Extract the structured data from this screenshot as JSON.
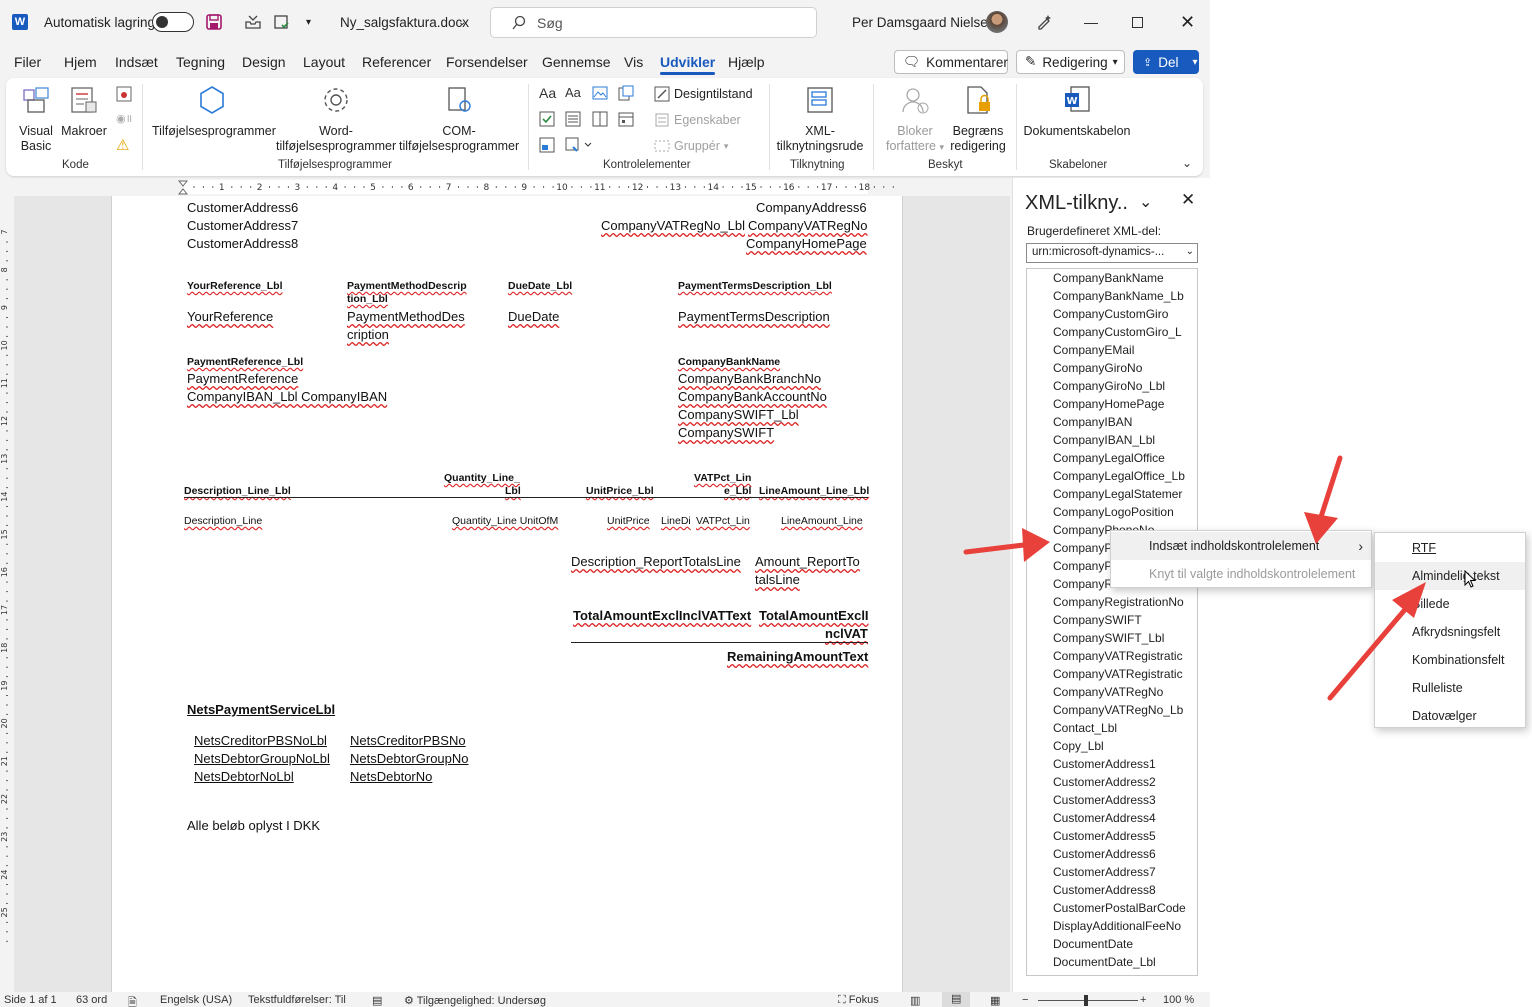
{
  "titlebar": {
    "autosave_label": "Automatisk lagring",
    "doc_name": "Ny_salgsfaktura.docx",
    "search_placeholder": "Søg",
    "user_name": "Per Damsgaard Nielsen"
  },
  "menu": [
    "Filer",
    "Hjem",
    "Indsæt",
    "Tegning",
    "Design",
    "Layout",
    "Referencer",
    "Forsendelser",
    "Gennemse",
    "Vis",
    "Udvikler",
    "Hjælp"
  ],
  "actions": {
    "comments": "Kommentarer",
    "editing": "Redigering",
    "share": "Del"
  },
  "ribbon": {
    "vb_l1": "Visual",
    "vb_l2": "Basic",
    "macros": "Makroer",
    "grp_code": "Kode",
    "addins": "Tilføjelsesprogrammer",
    "word_addins_l1": "Word-",
    "word_addins_l2": "tilføjelsesprogrammer",
    "com_addins_l1": "COM-",
    "com_addins_l2": "tilføjelsesprogrammer",
    "grp_addins": "Tilføjelsesprogrammer",
    "design_mode": "Designtilstand",
    "properties": "Egenskaber",
    "group": "Gruppér",
    "grp_controls": "Kontrolelementer",
    "xml_pane_l1": "XML-",
    "xml_pane_l2": "tilknytningsrude",
    "grp_mapping": "Tilknytning",
    "block_l1": "Bloker",
    "block_l2": "forfattere",
    "restrict_l1": "Begræns",
    "restrict_l2": "redigering",
    "grp_protect": "Beskyt",
    "doc_template": "Dokumentskabelon",
    "grp_templates": "Skabeloner"
  },
  "ruler_numbers": [
    "1",
    "2",
    "3",
    "4",
    "5",
    "6",
    "7",
    "8",
    "9",
    "10",
    "11",
    "12",
    "13",
    "14",
    "15",
    "16",
    "17",
    "18"
  ],
  "vruler_numbers": [
    "7",
    "8",
    "9",
    "10",
    "11",
    "12",
    "13",
    "14",
    "15",
    "16",
    "17",
    "18",
    "19",
    "20",
    "21",
    "22",
    "23",
    "24",
    "25"
  ],
  "doc": {
    "ca6": "CustomerAddress6",
    "ca7": "CustomerAddress7",
    "ca8": "CustomerAddress8",
    "coa6": "CompanyAddress6",
    "vat_lbl": "CompanyVATRegNo_Lbl",
    "vat": "CompanyVATRegNo",
    "homepage": "CompanyHomePage",
    "yourref_lbl": "YourReference_Lbl",
    "pmd_lbl_1": "PaymentMethodDescrip",
    "pmd_lbl_2": "tion_Lbl",
    "due_lbl": "DueDate_Lbl",
    "pt_lbl": "PaymentTermsDescription_Lbl",
    "yourref": "YourReference",
    "pmd_1": "PaymentMethodDes",
    "pmd_2": "cription",
    "due": "DueDate",
    "pt": "PaymentTermsDescription",
    "payref_lbl": "PaymentReference_Lbl",
    "bankname": "CompanyBankName",
    "payref": "PaymentReference",
    "branch": "CompanyBankBranchNo",
    "iban_line": "CompanyIBAN_Lbl CompanyIBAN",
    "account": "CompanyBankAccountNo",
    "swift_lbl": "CompanySWIFT_Lbl",
    "swift": "CompanySWIFT",
    "qty_lbl_1": "Quantity_Line_",
    "qty_lbl_2": "Lbl",
    "vat_line_1": "VATPct_Lin",
    "vat_line_2": "e_Lbl",
    "desc_lbl": "Description_Line_Lbl",
    "unitprice_lbl": "UnitPrice_Lbl",
    "lineamt_lbl": "LineAmount_Line_Lbl",
    "desc": "Description_Line",
    "qty_uom": "Quantity_Line UnitOfM",
    "unitprice": "UnitPrice",
    "linedi": "LineDi",
    "vatpct": "VATPct_Lin",
    "lineamt": "LineAmount_Line",
    "desc_tot": "Description_ReportTotalsLine",
    "amt_tot_1": "Amount_ReportTo",
    "amt_tot_2": "talsLine",
    "total_text": "TotalAmountExclInclVATText",
    "total_1": "TotalAmountExclI",
    "total_2": "nclVAT",
    "remaining": "RemainingAmountText",
    "nets_lbl": "NetsPaymentServiceLbl",
    "nets_cred_lbl": "NetsCreditorPBSNoLbl",
    "nets_cred": "NetsCreditorPBSNo",
    "nets_grp_lbl": "NetsDebtorGroupNoLbl",
    "nets_grp": "NetsDebtorGroupNo",
    "nets_deb_lbl": "NetsDebtorNoLbl",
    "nets_deb": "NetsDebtorNo",
    "footer_1": "Alle",
    "footer_2": "beløb",
    "footer_3": "oplyst",
    "footer_4": "I DKK"
  },
  "pane": {
    "title": "XML-tilkny..",
    "custom_label": "Brugerdefineret XML-del:",
    "dropdown": "urn:microsoft-dynamics-...",
    "items": [
      "CompanyBankName",
      "CompanyBankName_Lb",
      "CompanyCustomGiro",
      "CompanyCustomGiro_L",
      "CompanyEMail",
      "CompanyGiroNo",
      "CompanyGiroNo_Lbl",
      "CompanyHomePage",
      "CompanyIBAN",
      "CompanyIBAN_Lbl",
      "CompanyLegalOffice",
      "CompanyLegalOffice_Lb",
      "CompanyLegalStatemer",
      "CompanyLogoPosition",
      "CompanyPhoneNo",
      "CompanyP",
      "CompanyP",
      "CompanyR",
      "CompanyRegistrationNo",
      "CompanySWIFT",
      "CompanySWIFT_Lbl",
      "CompanyVATRegistratic",
      "CompanyVATRegistratic",
      "CompanyVATRegNo",
      "CompanyVATRegNo_Lb",
      "Contact_Lbl",
      "Copy_Lbl",
      "CustomerAddress1",
      "CustomerAddress2",
      "CustomerAddress3",
      "CustomerAddress4",
      "CustomerAddress5",
      "CustomerAddress6",
      "CustomerAddress7",
      "CustomerAddress8",
      "CustomerPostalBarCode",
      "DisplayAdditionalFeeNo",
      "DocumentDate",
      "DocumentDate_Lbl"
    ]
  },
  "context_menu": {
    "insert": "Indsæt indholdskontrolelement",
    "map": "Knyt til valgte indholdskontrolelement"
  },
  "submenu": [
    "RTF",
    "Almindelig tekst",
    "Billede",
    "Afkrydsningsfelt",
    "Kombinationsfelt",
    "Rulleliste",
    "Datovælger"
  ],
  "status": {
    "page": "Side 1 af 1",
    "words": "63 ord",
    "lang": "Engelsk (USA)",
    "predict": "Tekstfuldførelser: Til",
    "access": "Tilgængelighed: Undersøg",
    "focus": "Fokus",
    "zoom": "100 %"
  },
  "colors": {
    "accent": "#185abd",
    "arrow": "#e8403a"
  }
}
